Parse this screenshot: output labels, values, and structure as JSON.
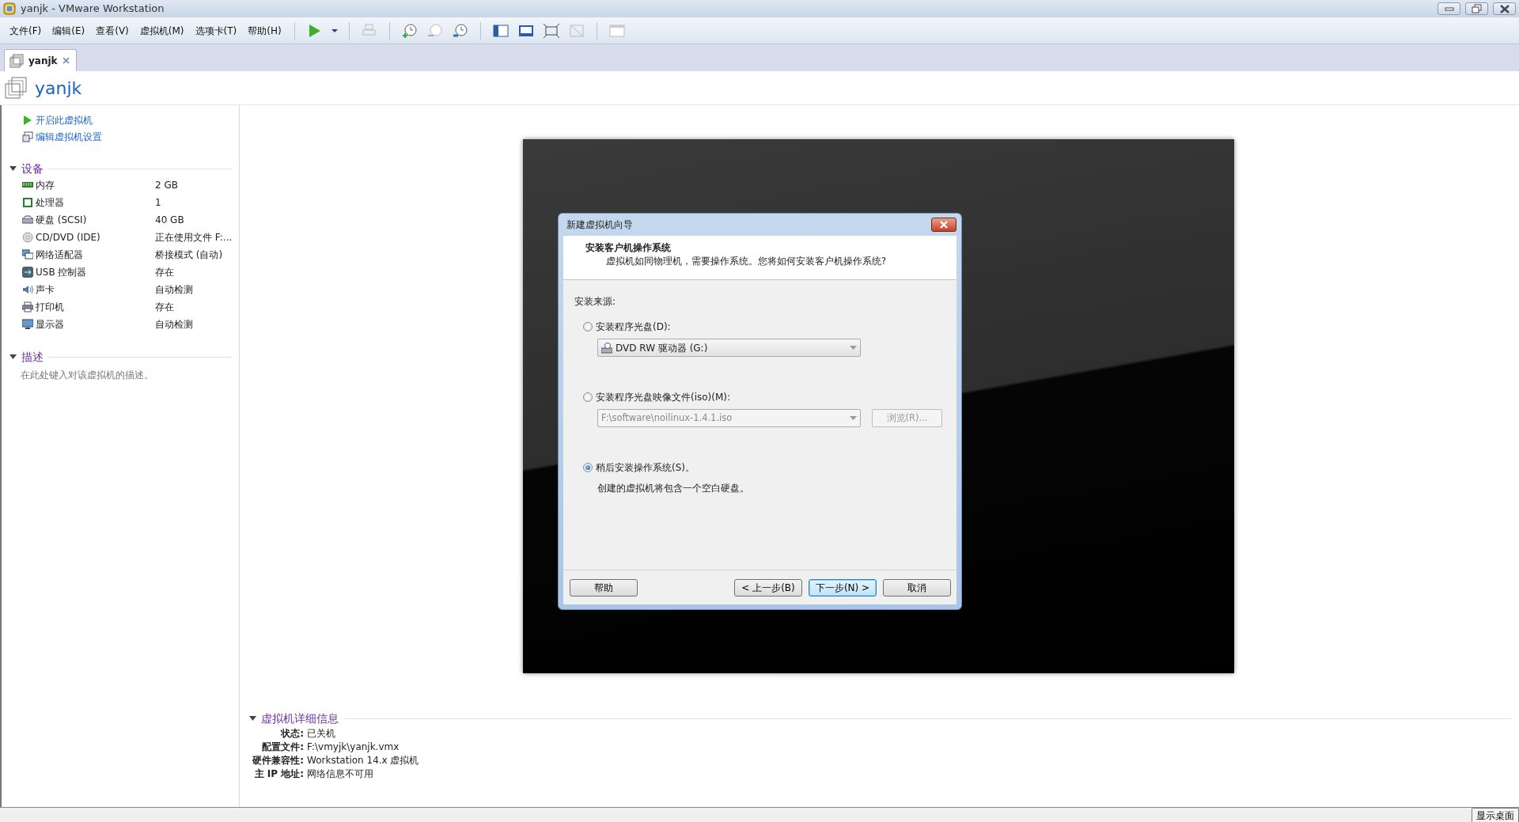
{
  "window": {
    "title": "yanjk - VMware Workstation"
  },
  "menu": [
    "文件(F)",
    "编辑(E)",
    "查看(V)",
    "虚拟机(M)",
    "选项卡(T)",
    "帮助(H)"
  ],
  "tabs": [
    {
      "label": "yanjk",
      "selected": true
    }
  ],
  "vm_title": "yanjk",
  "actions": [
    "开启此虚拟机",
    "编辑虚拟机设置"
  ],
  "devices": {
    "title": "设备",
    "expanded": true,
    "items": [
      {
        "name": "内存",
        "value": "2 GB"
      },
      {
        "name": "处理器",
        "value": "1"
      },
      {
        "name": "硬盘 (SCSI)",
        "value": "40 GB"
      },
      {
        "name": "CD/DVD (IDE)",
        "value": "正在使用文件 F:..."
      },
      {
        "name": "网络适配器",
        "value": "桥接模式 (自动)"
      },
      {
        "name": "USB 控制器",
        "value": "存在"
      },
      {
        "name": "声卡",
        "value": "自动检测"
      },
      {
        "name": "打印机",
        "value": "存在"
      },
      {
        "name": "显示器",
        "value": "自动检测"
      }
    ]
  },
  "description": {
    "title": "描述",
    "expanded": true,
    "placeholder": "在此处键入对该虚拟机的描述。"
  },
  "details": {
    "title": "虚拟机详细信息",
    "expanded": true,
    "rows": [
      {
        "label": "状态:",
        "value": "已关机"
      },
      {
        "label": "配置文件:",
        "value": "F:\\vmyjk\\yanjk.vmx"
      },
      {
        "label": "硬件兼容性:",
        "value": "Workstation 14.x 虚拟机"
      },
      {
        "label": "主 IP 地址:",
        "value": "网络信息不可用"
      }
    ]
  },
  "dialog": {
    "title": "新建虚拟机向导",
    "heading": "安装客户机操作系统",
    "subheading": "虚拟机如同物理机，需要操作系统。您将如何安装客户机操作系统?",
    "source_label": "安装来源:",
    "options": [
      {
        "kind": "drive",
        "label": "安装程序光盘(D):",
        "selected": false,
        "field": {
          "value": "DVD RW 驱动器 (G:)",
          "disabled": false
        }
      },
      {
        "kind": "image",
        "label": "安装程序光盘映像文件(iso)(M):",
        "selected": false,
        "field": {
          "value": "F:\\software\\noilinux-1.4.1.iso",
          "disabled": true
        },
        "browse": {
          "label": "浏览(R)...",
          "disabled": true
        }
      },
      {
        "kind": "later",
        "label": "稍后安装操作系统(S)。",
        "selected": true,
        "note": "创建的虚拟机将包含一个空白硬盘。"
      }
    ],
    "buttons": [
      {
        "label": "帮助",
        "default": false
      },
      {
        "label": "< 上一步(B)",
        "default": false
      },
      {
        "label": "下一步(N) >",
        "default": true
      },
      {
        "label": "取消",
        "default": false
      }
    ]
  },
  "status_bar": {
    "button": "显示桌面"
  }
}
